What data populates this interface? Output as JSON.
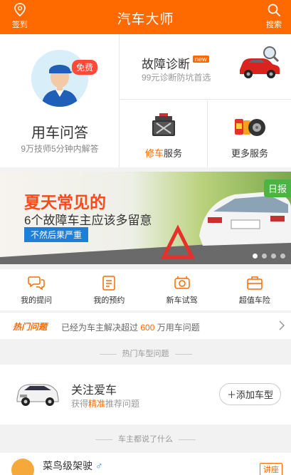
{
  "header": {
    "title": "汽车大师",
    "checkin_label": "签到",
    "search_label": "搜索",
    "color": "#ff6a00"
  },
  "services": {
    "qa": {
      "title": "用车问答",
      "subtitle": "9万技师5分钟内解答",
      "badge": "免费"
    },
    "diagnosis": {
      "title": "故障诊断",
      "badge": "new",
      "subtitle": "99元诊断防坑首选"
    },
    "repair": {
      "label_highlight": "修车",
      "label_rest": "服务"
    },
    "more": {
      "label": "更多服务"
    }
  },
  "banner": {
    "title": "夏天常见的",
    "subtitle": "6个故障车主应该多留意",
    "tag": "不然后果严重",
    "daily_label": "日报",
    "slide_count": 4,
    "active_slide": 1
  },
  "shortcuts": [
    {
      "label": "我的提问",
      "icon": "chat-bubbles-icon"
    },
    {
      "label": "我的预约",
      "icon": "clipboard-icon"
    },
    {
      "label": "新车试驾",
      "icon": "steering-icon"
    },
    {
      "label": "超值车险",
      "icon": "briefcase-icon"
    }
  ],
  "hot": {
    "tag": "热门问题",
    "text_before": "已经为车主解决超过",
    "count": "600",
    "text_after": "万用车问题"
  },
  "section_hot_models": "热门车型问题",
  "my_car": {
    "title": "关注爱车",
    "sub_before": "获得",
    "sub_highlight": "精准",
    "sub_after": "推荐问题",
    "add_button": "＋添加车型"
  },
  "section_owners": "车主都说了什么",
  "user": {
    "name": "菜鸟级架驶",
    "gender": "♂",
    "tag": "讲座"
  }
}
